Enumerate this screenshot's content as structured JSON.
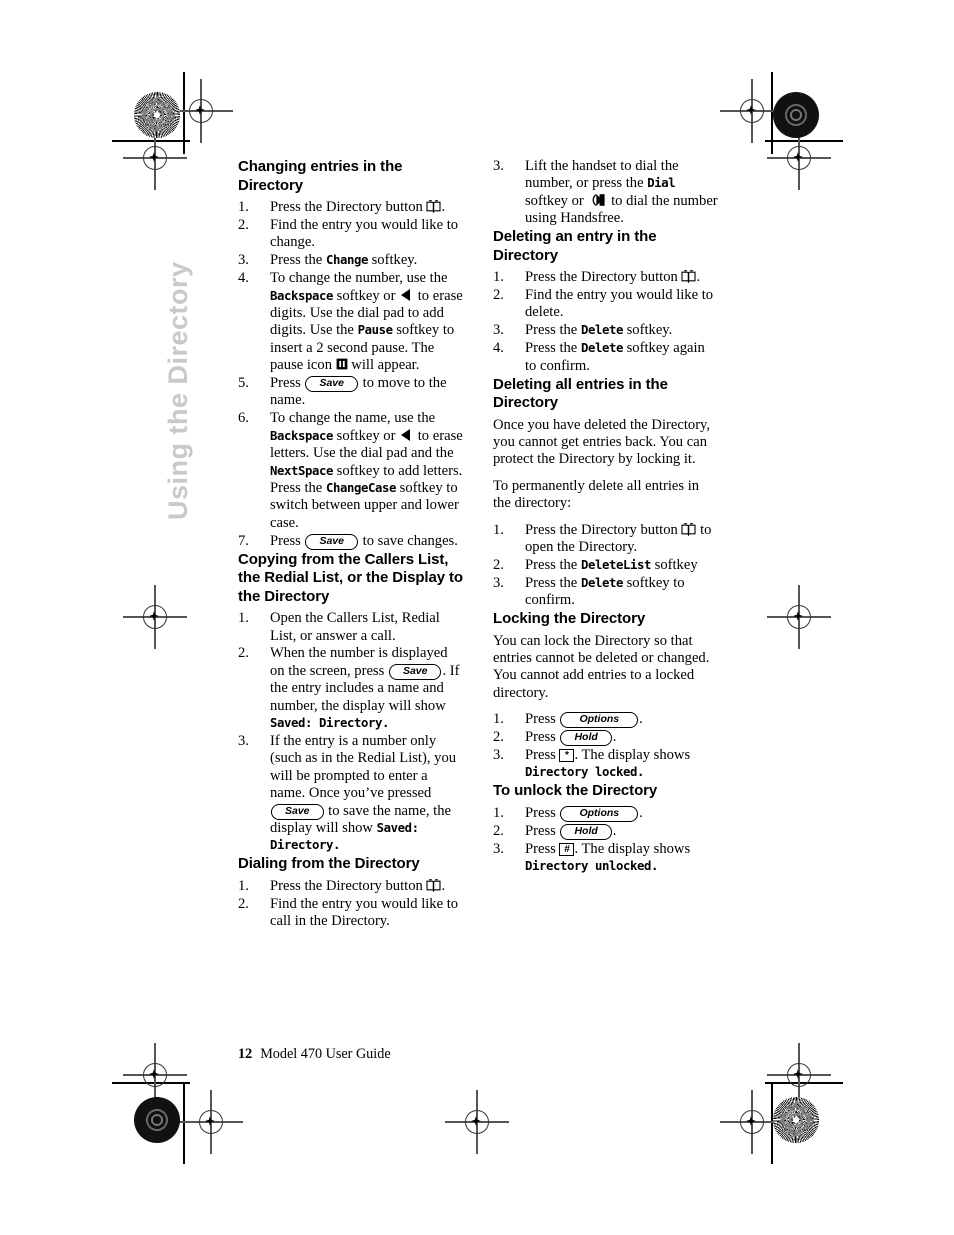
{
  "side_tab": {
    "label": "Using the Directory",
    "color": "#c9c9c9"
  },
  "footer": {
    "page_number": "12",
    "title": "Model 470 User Guide"
  },
  "icons": {
    "directory_button": "open-book-icon",
    "erase_key": "left-triangle-icon",
    "pause": "pause-icon",
    "handsfree": "handsfree-speaker-icon"
  },
  "keys": {
    "save": "Save",
    "options": "Options",
    "hold": "Hold",
    "star": "*",
    "pound": "#"
  },
  "left_column": {
    "section1": {
      "heading": "Changing entries in the Directory",
      "steps": [
        {
          "num": "1.",
          "parts": [
            {
              "t": "text",
              "v": "Press the Directory button "
            },
            {
              "t": "icon",
              "v": "directory-button-icon"
            },
            {
              "t": "text",
              "v": "."
            }
          ]
        },
        {
          "num": "2.",
          "parts": [
            {
              "t": "text",
              "v": "Find the entry you would like to change."
            }
          ]
        },
        {
          "num": "3.",
          "parts": [
            {
              "t": "text",
              "v": "Press the "
            },
            {
              "t": "lcd",
              "v": "Change"
            },
            {
              "t": "text",
              "v": " softkey."
            }
          ]
        },
        {
          "num": "4.",
          "parts": [
            {
              "t": "text",
              "v": "To change the number, use the "
            },
            {
              "t": "lcd",
              "v": "Backspace"
            },
            {
              "t": "text",
              "v": " softkey or "
            },
            {
              "t": "icon",
              "v": "left-triangle-icon"
            },
            {
              "t": "text",
              "v": " to erase digits. Use the dial pad to add digits. Use the "
            },
            {
              "t": "lcd",
              "v": "Pause"
            },
            {
              "t": "text",
              "v": " softkey to insert a 2 second pause. The pause icon "
            },
            {
              "t": "icon",
              "v": "pause-icon"
            },
            {
              "t": "text",
              "v": " will appear."
            }
          ]
        },
        {
          "num": "5.",
          "parts": [
            {
              "t": "text",
              "v": "Press "
            },
            {
              "t": "pill",
              "v": "Save"
            },
            {
              "t": "text",
              "v": " to move to the name."
            }
          ]
        },
        {
          "num": "6.",
          "parts": [
            {
              "t": "text",
              "v": "To change the name, use the "
            },
            {
              "t": "lcd",
              "v": "Backspace"
            },
            {
              "t": "text",
              "v": " softkey or "
            },
            {
              "t": "icon",
              "v": "left-triangle-icon"
            },
            {
              "t": "text",
              "v": " to erase letters. Use the dial pad and the "
            },
            {
              "t": "lcd",
              "v": "NextSpace"
            },
            {
              "t": "text",
              "v": " softkey to add letters. Press the "
            },
            {
              "t": "lcd",
              "v": "ChangeCase"
            },
            {
              "t": "text",
              "v": " softkey to switch between upper and lower case."
            }
          ]
        },
        {
          "num": "7.",
          "parts": [
            {
              "t": "text",
              "v": "Press "
            },
            {
              "t": "pill",
              "v": "Save"
            },
            {
              "t": "text",
              "v": " to save changes."
            }
          ]
        }
      ]
    },
    "section2": {
      "heading": "Copying from the Callers List, the Redial List, or the Display to the Directory",
      "steps": [
        {
          "num": "1.",
          "parts": [
            {
              "t": "text",
              "v": "Open the Callers List, Redial List, or answer a call."
            }
          ]
        },
        {
          "num": "2.",
          "parts": [
            {
              "t": "text",
              "v": "When the number is displayed on the screen, press "
            },
            {
              "t": "pill",
              "v": "Save"
            },
            {
              "t": "text",
              "v": ". If the entry includes a name and number, the display will show "
            },
            {
              "t": "lcd",
              "v": "Saved:  Directory."
            }
          ]
        },
        {
          "num": "3.",
          "parts": [
            {
              "t": "text",
              "v": "If the entry is a number only (such as in the Redial List), you will be prompted to enter a name. Once you’ve pressed "
            },
            {
              "t": "pill",
              "v": "Save"
            },
            {
              "t": "text",
              "v": " to save the name, the display will show "
            },
            {
              "t": "lcd",
              "v": "Saved: Directory."
            }
          ]
        }
      ]
    },
    "section3": {
      "heading": "Dialing from the Directory",
      "steps": [
        {
          "num": "1.",
          "parts": [
            {
              "t": "text",
              "v": "Press the Directory button "
            },
            {
              "t": "icon",
              "v": "directory-button-icon"
            },
            {
              "t": "text",
              "v": "."
            }
          ]
        },
        {
          "num": "2.",
          "parts": [
            {
              "t": "text",
              "v": "Find the entry you would like to call in the Directory."
            }
          ]
        }
      ]
    }
  },
  "right_column": {
    "section1_continued": {
      "steps": [
        {
          "num": "3.",
          "parts": [
            {
              "t": "text",
              "v": "Lift the handset to dial the number, or press the "
            },
            {
              "t": "lcd",
              "v": "Dial"
            },
            {
              "t": "text",
              "v": " softkey or "
            },
            {
              "t": "icon",
              "v": "handsfree-icon"
            },
            {
              "t": "text",
              "v": " to dial the number using Handsfree."
            }
          ]
        }
      ]
    },
    "section2": {
      "heading": "Deleting an entry in the Directory",
      "steps": [
        {
          "num": "1.",
          "parts": [
            {
              "t": "text",
              "v": "Press the Directory button "
            },
            {
              "t": "icon",
              "v": "directory-button-icon"
            },
            {
              "t": "text",
              "v": "."
            }
          ]
        },
        {
          "num": "2.",
          "parts": [
            {
              "t": "text",
              "v": "Find the entry you would like to delete."
            }
          ]
        },
        {
          "num": "3.",
          "parts": [
            {
              "t": "text",
              "v": "Press the "
            },
            {
              "t": "lcd",
              "v": "Delete"
            },
            {
              "t": "text",
              "v": " softkey."
            }
          ]
        },
        {
          "num": "4.",
          "parts": [
            {
              "t": "text",
              "v": "Press the "
            },
            {
              "t": "lcd",
              "v": "Delete"
            },
            {
              "t": "text",
              "v": " softkey again to confirm."
            }
          ]
        }
      ]
    },
    "section3": {
      "heading": "Deleting all entries in the Directory",
      "paragraphs": [
        "Once you have deleted the Directory, you cannot get entries back. You can protect the Directory by locking it.",
        "To permanently delete all entries in the directory:"
      ],
      "steps": [
        {
          "num": "1.",
          "parts": [
            {
              "t": "text",
              "v": "Press the Directory button "
            },
            {
              "t": "icon",
              "v": "directory-button-icon"
            },
            {
              "t": "text",
              "v": " to open the Directory."
            }
          ]
        },
        {
          "num": "2.",
          "parts": [
            {
              "t": "text",
              "v": "Press the "
            },
            {
              "t": "lcd",
              "v": "DeleteList"
            },
            {
              "t": "text",
              "v": "  softkey"
            }
          ]
        },
        {
          "num": "3.",
          "parts": [
            {
              "t": "text",
              "v": "Press the "
            },
            {
              "t": "lcd",
              "v": "Delete"
            },
            {
              "t": "text",
              "v": " softkey to confirm."
            }
          ]
        }
      ]
    },
    "section4": {
      "heading": "Locking the Directory",
      "paragraphs": [
        "You can lock the Directory so that entries cannot be deleted or changed. You cannot add entries to a locked directory."
      ],
      "steps": [
        {
          "num": "1.",
          "parts": [
            {
              "t": "text",
              "v": "Press "
            },
            {
              "t": "pill",
              "v": "Options"
            },
            {
              "t": "text",
              "v": "."
            }
          ]
        },
        {
          "num": "2.",
          "parts": [
            {
              "t": "text",
              "v": "Press "
            },
            {
              "t": "pill",
              "v": "Hold"
            },
            {
              "t": "text",
              "v": "."
            }
          ]
        },
        {
          "num": "3.",
          "parts": [
            {
              "t": "text",
              "v": "Press "
            },
            {
              "t": "keycap",
              "v": "*"
            },
            {
              "t": "text",
              "v": ". The display shows "
            },
            {
              "t": "lcd",
              "v": "Directory locked."
            }
          ]
        }
      ]
    },
    "section5": {
      "heading": "To unlock the Directory",
      "steps": [
        {
          "num": "1.",
          "parts": [
            {
              "t": "text",
              "v": "Press "
            },
            {
              "t": "pill",
              "v": "Options"
            },
            {
              "t": "text",
              "v": "."
            }
          ]
        },
        {
          "num": "2.",
          "parts": [
            {
              "t": "text",
              "v": "Press "
            },
            {
              "t": "pill",
              "v": "Hold"
            },
            {
              "t": "text",
              "v": "."
            }
          ]
        },
        {
          "num": "3.",
          "parts": [
            {
              "t": "text",
              "v": "Press "
            },
            {
              "t": "keycap",
              "v": "#"
            },
            {
              "t": "text",
              "v": ". The display shows "
            },
            {
              "t": "lcd",
              "v": "Directory unlocked."
            }
          ]
        }
      ]
    }
  }
}
